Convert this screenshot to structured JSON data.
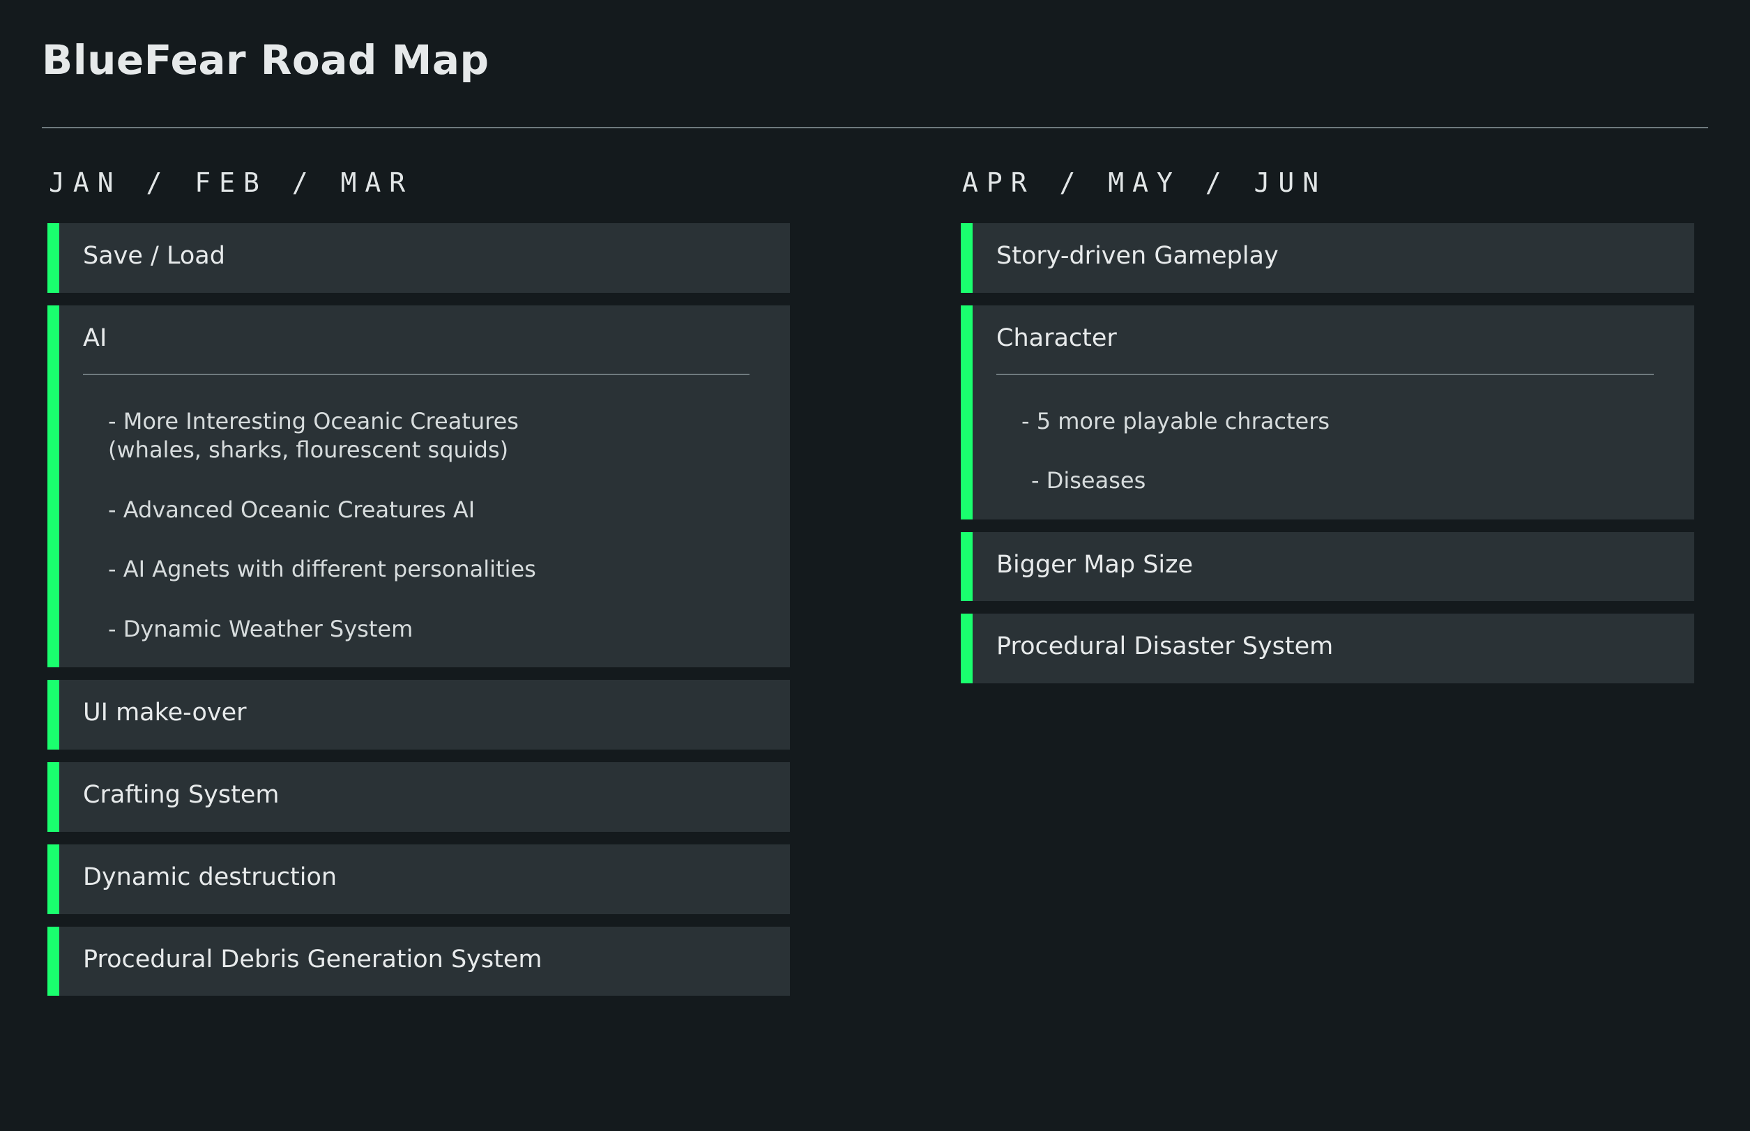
{
  "header": {
    "title": "BlueFear Road Map"
  },
  "columns": [
    {
      "heading": "JAN / FEB / MAR",
      "cards": [
        {
          "title": "Save / Load",
          "items": []
        },
        {
          "title": "AI",
          "items": [
            "- More Interesting Oceanic Creatures\n  (whales, sharks, flourescent squids)",
            "- Advanced Oceanic Creatures AI",
            "- AI Agnets with different personalities",
            "- Dynamic Weather System"
          ]
        },
        {
          "title": "UI make-over",
          "items": []
        },
        {
          "title": "Crafting System",
          "items": []
        },
        {
          "title": "Dynamic destruction",
          "items": []
        },
        {
          "title": "Procedural Debris Generation System",
          "items": []
        }
      ]
    },
    {
      "heading": "APR / MAY / JUN",
      "cards": [
        {
          "title": "Story-driven Gameplay",
          "items": []
        },
        {
          "title": "Character",
          "items": [
            "- 5 more playable chracters",
            "- Diseases"
          ]
        },
        {
          "title": "Bigger Map Size",
          "items": []
        },
        {
          "title": "Procedural Disaster System",
          "items": []
        }
      ]
    }
  ],
  "colors": {
    "background": "#141a1d",
    "card": "#2a3236",
    "accent": "#1aff6e",
    "text": "#e7eaeb",
    "muted_text": "#d7dcdd",
    "rule": "#6f7a7e"
  }
}
